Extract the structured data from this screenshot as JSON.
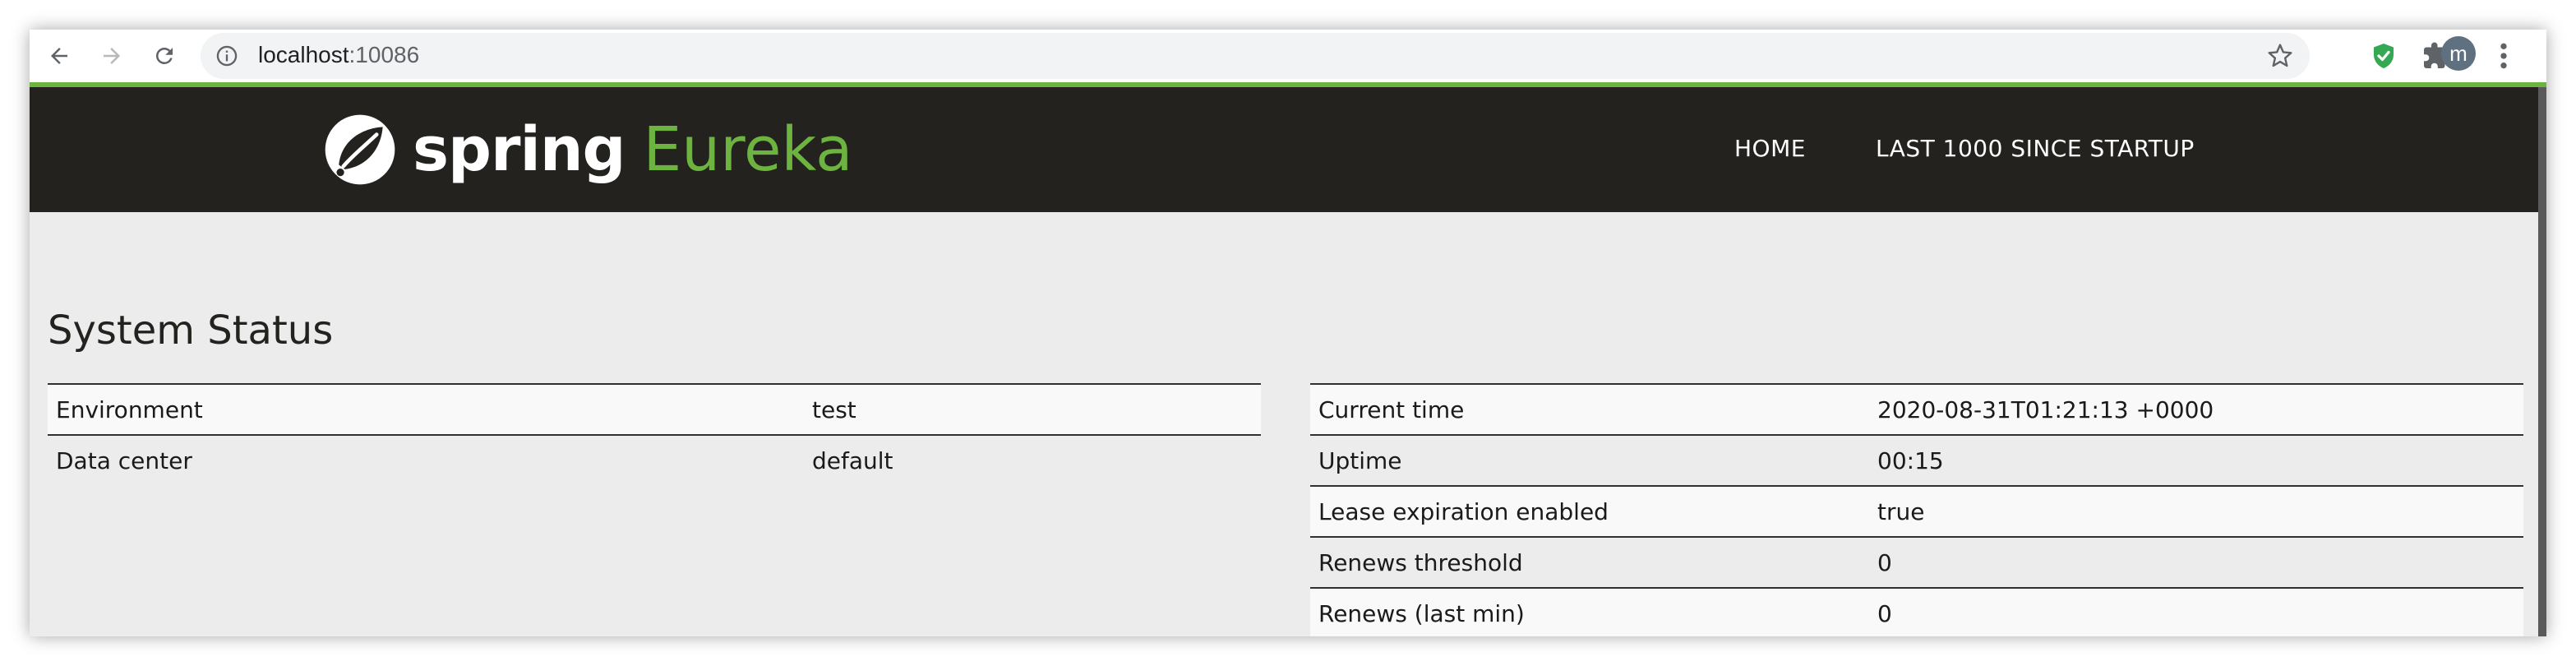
{
  "browser": {
    "url_host": "localhost",
    "url_port": ":10086",
    "profile_initial": "m",
    "icons": {
      "back": "back-arrow-icon",
      "forward": "forward-arrow-icon",
      "reload": "reload-icon",
      "site_info": "info-icon",
      "bookmark": "star-icon",
      "extension_shield": "shield-check-icon",
      "extensions": "puzzle-icon",
      "menu": "kebab-menu-icon"
    },
    "accent_color": "#6db33f"
  },
  "header": {
    "logo_spring": "spring",
    "logo_eureka": "Eureka",
    "nav": [
      {
        "label": "HOME"
      },
      {
        "label": "LAST 1000 SINCE STARTUP"
      }
    ],
    "background_color": "#24221f"
  },
  "system_status": {
    "title": "System Status",
    "left_table": [
      {
        "key": "Environment",
        "value": "test"
      },
      {
        "key": "Data center",
        "value": "default"
      }
    ],
    "right_table": [
      {
        "key": "Current time",
        "value": "2020-08-31T01:21:13 +0000"
      },
      {
        "key": "Uptime",
        "value": "00:15"
      },
      {
        "key": "Lease expiration enabled",
        "value": "true"
      },
      {
        "key": "Renews threshold",
        "value": "0"
      },
      {
        "key": "Renews (last min)",
        "value": "0"
      }
    ]
  }
}
